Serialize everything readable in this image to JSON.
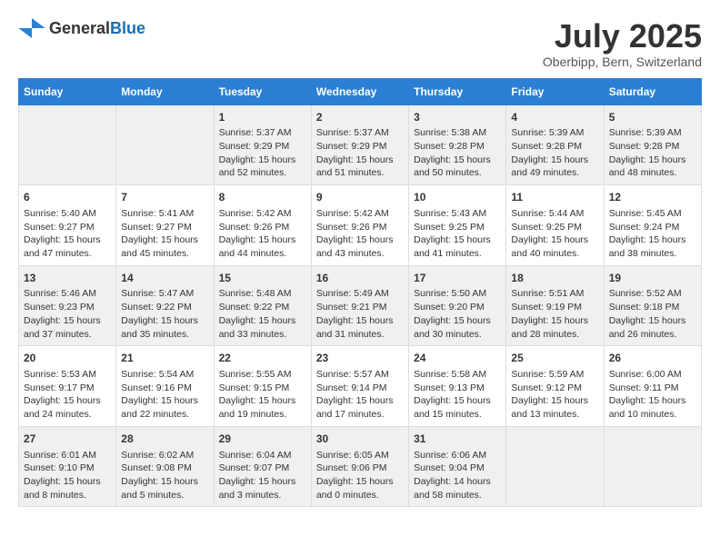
{
  "header": {
    "logo_general": "General",
    "logo_blue": "Blue",
    "month_year": "July 2025",
    "location": "Oberbipp, Bern, Switzerland"
  },
  "calendar": {
    "days_of_week": [
      "Sunday",
      "Monday",
      "Tuesday",
      "Wednesday",
      "Thursday",
      "Friday",
      "Saturday"
    ],
    "weeks": [
      [
        {
          "day": "",
          "info": ""
        },
        {
          "day": "",
          "info": ""
        },
        {
          "day": "1",
          "info": "Sunrise: 5:37 AM\nSunset: 9:29 PM\nDaylight: 15 hours\nand 52 minutes."
        },
        {
          "day": "2",
          "info": "Sunrise: 5:37 AM\nSunset: 9:29 PM\nDaylight: 15 hours\nand 51 minutes."
        },
        {
          "day": "3",
          "info": "Sunrise: 5:38 AM\nSunset: 9:28 PM\nDaylight: 15 hours\nand 50 minutes."
        },
        {
          "day": "4",
          "info": "Sunrise: 5:39 AM\nSunset: 9:28 PM\nDaylight: 15 hours\nand 49 minutes."
        },
        {
          "day": "5",
          "info": "Sunrise: 5:39 AM\nSunset: 9:28 PM\nDaylight: 15 hours\nand 48 minutes."
        }
      ],
      [
        {
          "day": "6",
          "info": "Sunrise: 5:40 AM\nSunset: 9:27 PM\nDaylight: 15 hours\nand 47 minutes."
        },
        {
          "day": "7",
          "info": "Sunrise: 5:41 AM\nSunset: 9:27 PM\nDaylight: 15 hours\nand 45 minutes."
        },
        {
          "day": "8",
          "info": "Sunrise: 5:42 AM\nSunset: 9:26 PM\nDaylight: 15 hours\nand 44 minutes."
        },
        {
          "day": "9",
          "info": "Sunrise: 5:42 AM\nSunset: 9:26 PM\nDaylight: 15 hours\nand 43 minutes."
        },
        {
          "day": "10",
          "info": "Sunrise: 5:43 AM\nSunset: 9:25 PM\nDaylight: 15 hours\nand 41 minutes."
        },
        {
          "day": "11",
          "info": "Sunrise: 5:44 AM\nSunset: 9:25 PM\nDaylight: 15 hours\nand 40 minutes."
        },
        {
          "day": "12",
          "info": "Sunrise: 5:45 AM\nSunset: 9:24 PM\nDaylight: 15 hours\nand 38 minutes."
        }
      ],
      [
        {
          "day": "13",
          "info": "Sunrise: 5:46 AM\nSunset: 9:23 PM\nDaylight: 15 hours\nand 37 minutes."
        },
        {
          "day": "14",
          "info": "Sunrise: 5:47 AM\nSunset: 9:22 PM\nDaylight: 15 hours\nand 35 minutes."
        },
        {
          "day": "15",
          "info": "Sunrise: 5:48 AM\nSunset: 9:22 PM\nDaylight: 15 hours\nand 33 minutes."
        },
        {
          "day": "16",
          "info": "Sunrise: 5:49 AM\nSunset: 9:21 PM\nDaylight: 15 hours\nand 31 minutes."
        },
        {
          "day": "17",
          "info": "Sunrise: 5:50 AM\nSunset: 9:20 PM\nDaylight: 15 hours\nand 30 minutes."
        },
        {
          "day": "18",
          "info": "Sunrise: 5:51 AM\nSunset: 9:19 PM\nDaylight: 15 hours\nand 28 minutes."
        },
        {
          "day": "19",
          "info": "Sunrise: 5:52 AM\nSunset: 9:18 PM\nDaylight: 15 hours\nand 26 minutes."
        }
      ],
      [
        {
          "day": "20",
          "info": "Sunrise: 5:53 AM\nSunset: 9:17 PM\nDaylight: 15 hours\nand 24 minutes."
        },
        {
          "day": "21",
          "info": "Sunrise: 5:54 AM\nSunset: 9:16 PM\nDaylight: 15 hours\nand 22 minutes."
        },
        {
          "day": "22",
          "info": "Sunrise: 5:55 AM\nSunset: 9:15 PM\nDaylight: 15 hours\nand 19 minutes."
        },
        {
          "day": "23",
          "info": "Sunrise: 5:57 AM\nSunset: 9:14 PM\nDaylight: 15 hours\nand 17 minutes."
        },
        {
          "day": "24",
          "info": "Sunrise: 5:58 AM\nSunset: 9:13 PM\nDaylight: 15 hours\nand 15 minutes."
        },
        {
          "day": "25",
          "info": "Sunrise: 5:59 AM\nSunset: 9:12 PM\nDaylight: 15 hours\nand 13 minutes."
        },
        {
          "day": "26",
          "info": "Sunrise: 6:00 AM\nSunset: 9:11 PM\nDaylight: 15 hours\nand 10 minutes."
        }
      ],
      [
        {
          "day": "27",
          "info": "Sunrise: 6:01 AM\nSunset: 9:10 PM\nDaylight: 15 hours\nand 8 minutes."
        },
        {
          "day": "28",
          "info": "Sunrise: 6:02 AM\nSunset: 9:08 PM\nDaylight: 15 hours\nand 5 minutes."
        },
        {
          "day": "29",
          "info": "Sunrise: 6:04 AM\nSunset: 9:07 PM\nDaylight: 15 hours\nand 3 minutes."
        },
        {
          "day": "30",
          "info": "Sunrise: 6:05 AM\nSunset: 9:06 PM\nDaylight: 15 hours\nand 0 minutes."
        },
        {
          "day": "31",
          "info": "Sunrise: 6:06 AM\nSunset: 9:04 PM\nDaylight: 14 hours\nand 58 minutes."
        },
        {
          "day": "",
          "info": ""
        },
        {
          "day": "",
          "info": ""
        }
      ]
    ]
  }
}
